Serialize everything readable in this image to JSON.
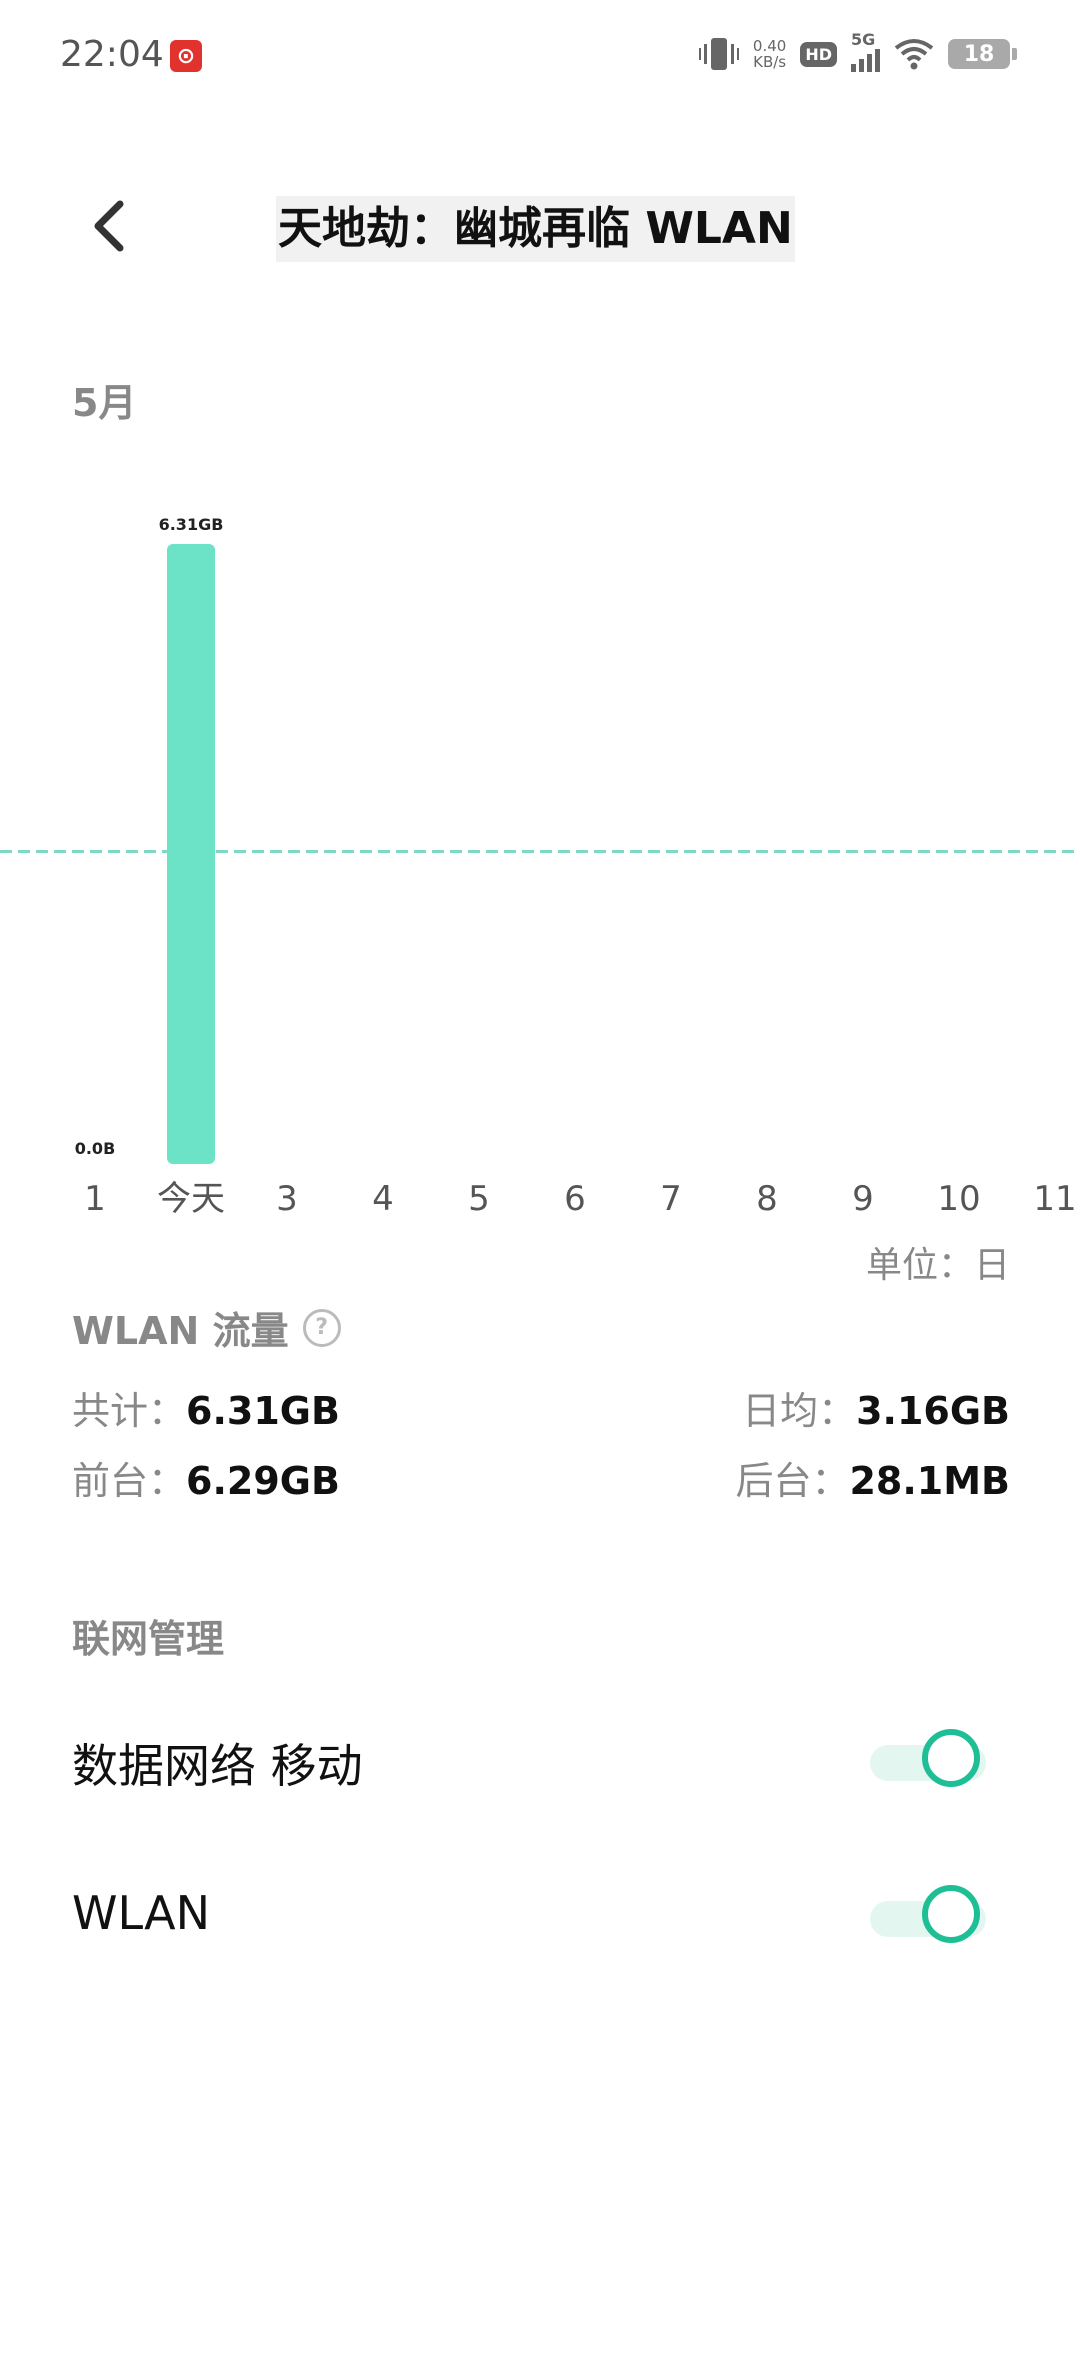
{
  "status_bar": {
    "time": "22:04",
    "app_badge": "⊙",
    "net_speed_value": "0.40",
    "net_speed_unit": "KB/s",
    "hd": "HD",
    "network": "5G",
    "battery": "18"
  },
  "header": {
    "title": "天地劫：幽城再临 WLAN"
  },
  "month_label": "5月",
  "chart_data": {
    "type": "bar",
    "categories": [
      "1",
      "今天",
      "3",
      "4",
      "5",
      "6",
      "7",
      "8",
      "9",
      "10",
      "11"
    ],
    "values": [
      0,
      6.31,
      0,
      0,
      0,
      0,
      0,
      0,
      0,
      0,
      0
    ],
    "value_labels": [
      "0.0B",
      "6.31GB"
    ],
    "average": 3.16,
    "unit": "GB",
    "ylim": [
      0,
      6.31
    ],
    "grid": false,
    "colors": {
      "bar": "#6ce3c6",
      "average_line": "#7fd7c8",
      "tick": "#555555"
    }
  },
  "unit_label": "单位：日",
  "wlan_stats": {
    "title": "WLAN 流量",
    "total_label": "共计：",
    "total_value": "6.31GB",
    "avg_label": "日均：",
    "avg_value": "3.16GB",
    "fg_label": "前台：",
    "fg_value": "6.29GB",
    "bg_label": "后台：",
    "bg_value": "28.1MB"
  },
  "network_management": {
    "title": "联网管理",
    "settings": [
      {
        "label": "数据网络 移动",
        "enabled": true
      },
      {
        "label": "WLAN",
        "enabled": true
      }
    ]
  },
  "colors": {
    "accent": "#1fbf96",
    "toggle_track": "#e3f6ef"
  }
}
